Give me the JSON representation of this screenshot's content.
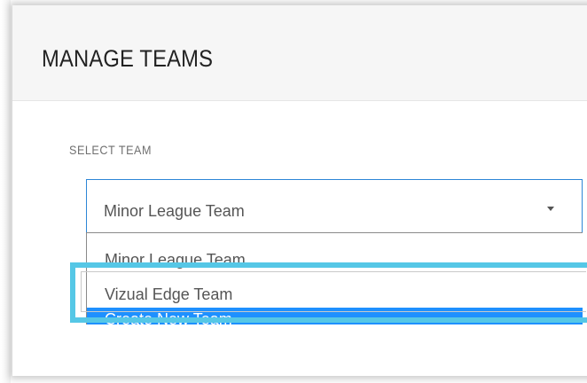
{
  "header": {
    "title": "MANAGE TEAMS"
  },
  "form": {
    "select_label": "SELECT TEAM",
    "selected_value": "Minor League Team",
    "options": [
      {
        "label": "Minor League Team",
        "state": "default"
      },
      {
        "label": "Vizual Edge Team",
        "state": "callout-highlighted"
      },
      {
        "label": "Create New Team",
        "state": "hovered"
      }
    ]
  },
  "colors": {
    "focus_border": "#2d86d6",
    "option_hover_bg": "#1e90ff",
    "callout": "#55c7e6",
    "header_bg": "#f6f6f6"
  },
  "icons": {
    "select_caret": "caret-down-icon"
  }
}
